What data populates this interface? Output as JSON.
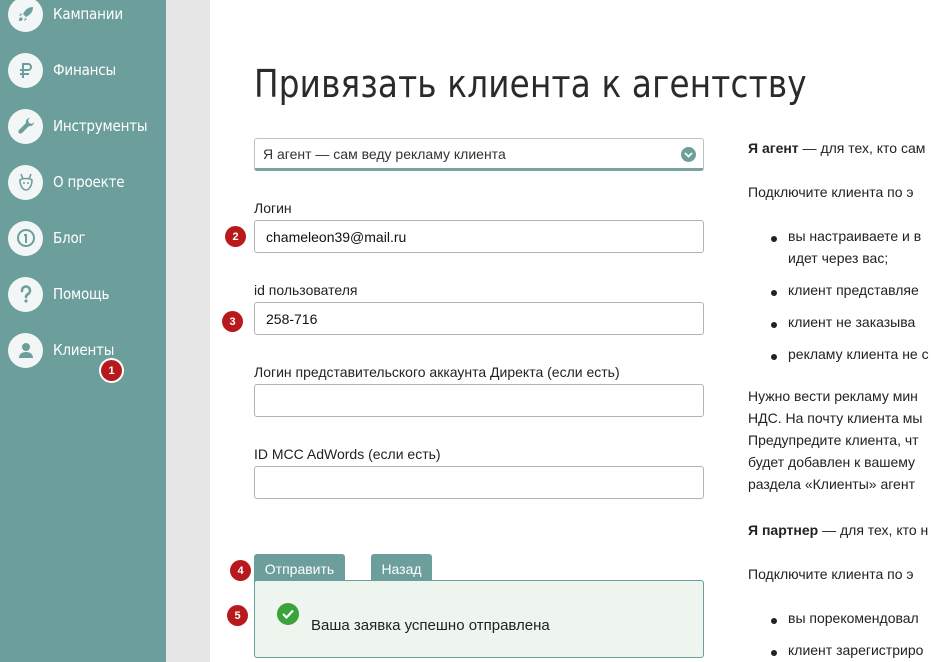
{
  "sidebar": {
    "items": [
      {
        "label": "Кампании",
        "icon": "rocket-icon"
      },
      {
        "label": "Финансы",
        "icon": "ruble-icon"
      },
      {
        "label": "Инструменты",
        "icon": "wrench-icon"
      },
      {
        "label": "О проекте",
        "icon": "chameleon-icon"
      },
      {
        "label": "Блог",
        "icon": "blog-icon"
      },
      {
        "label": "Помощь",
        "icon": "question-icon"
      },
      {
        "label": "Клиенты",
        "icon": "user-icon"
      }
    ]
  },
  "badges": [
    "1",
    "2",
    "3",
    "4",
    "5"
  ],
  "page": {
    "title": "Привязать клиента к агентству"
  },
  "form": {
    "role_select": "Я агент — сам веду рекламу клиента",
    "login_label": "Логин",
    "login_value": "chameleon39@mail.ru",
    "userid_label": "id пользователя",
    "userid_value": "258-716",
    "direct_label": "Логин представительского аккаунта Директа (если есть)",
    "direct_value": "",
    "adwords_label": "ID MCC AdWords (если есть)",
    "adwords_value": "",
    "submit_label": "Отправить",
    "back_label": "Назад",
    "success_message": "Ваша заявка успешно отправлена"
  },
  "info": {
    "agent_heading": "Я агент",
    "agent_heading_rest": " — для тех, кто сам",
    "agent_intro": "Подключите клиента по э",
    "agent_bullets": [
      "вы настраиваете и в",
      "идет через вас;",
      "клиент представляе",
      "клиент не заказыва",
      "рекламу клиента не с"
    ],
    "para_lines": [
      "Нужно вести рекламу мин",
      "НДС. На почту клиента мы",
      "Предупредите клиента, чт",
      "будет добавлен к вашему",
      "раздела «Клиенты» агент"
    ],
    "partner_heading": "Я партнер",
    "partner_heading_rest": " — для тех, кто н",
    "partner_intro": "Подключите клиента по э",
    "partner_bullets": [
      "вы порекомендовал",
      "клиент зарегистриро"
    ]
  },
  "colors": {
    "sidebar": "#6c9f9b",
    "accent": "#6c9f9b",
    "badge": "#b8191d",
    "success": "#3aa33a"
  }
}
